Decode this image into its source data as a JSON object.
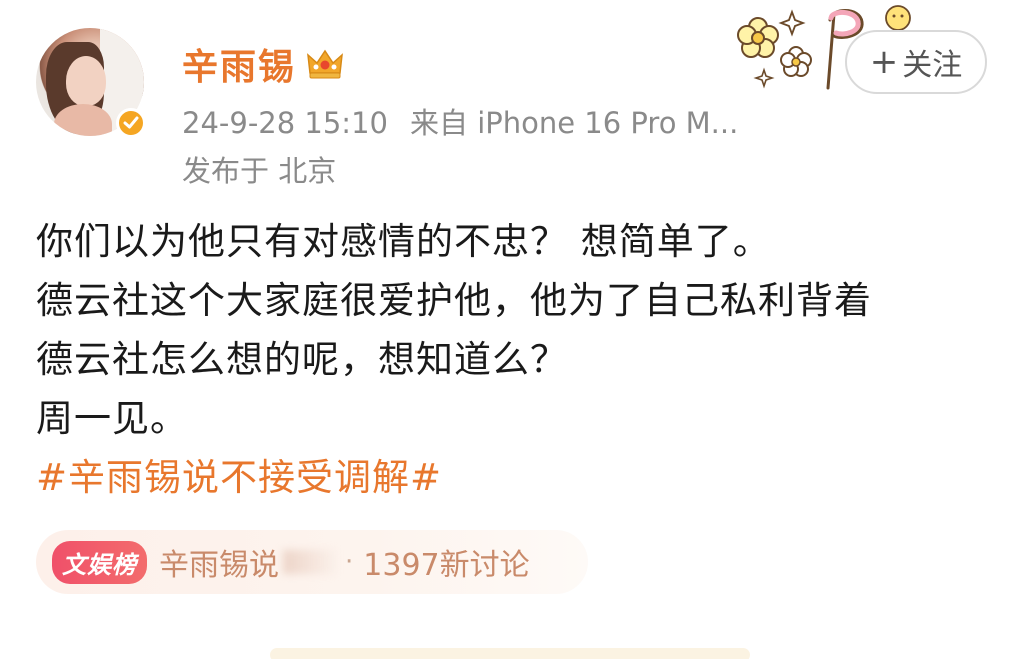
{
  "post": {
    "username": "辛雨锡",
    "timestamp": "24-9-28 15:10",
    "source": "来自 iPhone 16 Pro M...",
    "location": "发布于 北京",
    "follow_label": "关注",
    "follow_plus": "+",
    "lines": [
      "你们以为他只有对感情的不忠？ 想简单了。",
      "德云社这个大家庭很爱护他，他为了自己私利背着",
      "德云社怎么想的呢，想知道么？",
      "周一见。"
    ],
    "hashtag": "#辛雨锡说不接受调解#"
  },
  "trend": {
    "badge": "文娱榜",
    "title": "辛雨锡说",
    "separator": "·",
    "count": "1397新讨论"
  },
  "colors": {
    "accent": "#e8772d",
    "meta": "#8a8a8a",
    "badge_red": "#f0506a",
    "verify": "#f5a623"
  },
  "icons": {
    "crown": "crown-icon",
    "verify": "verified-badge-icon",
    "deco": "flower-sticker-icon"
  }
}
